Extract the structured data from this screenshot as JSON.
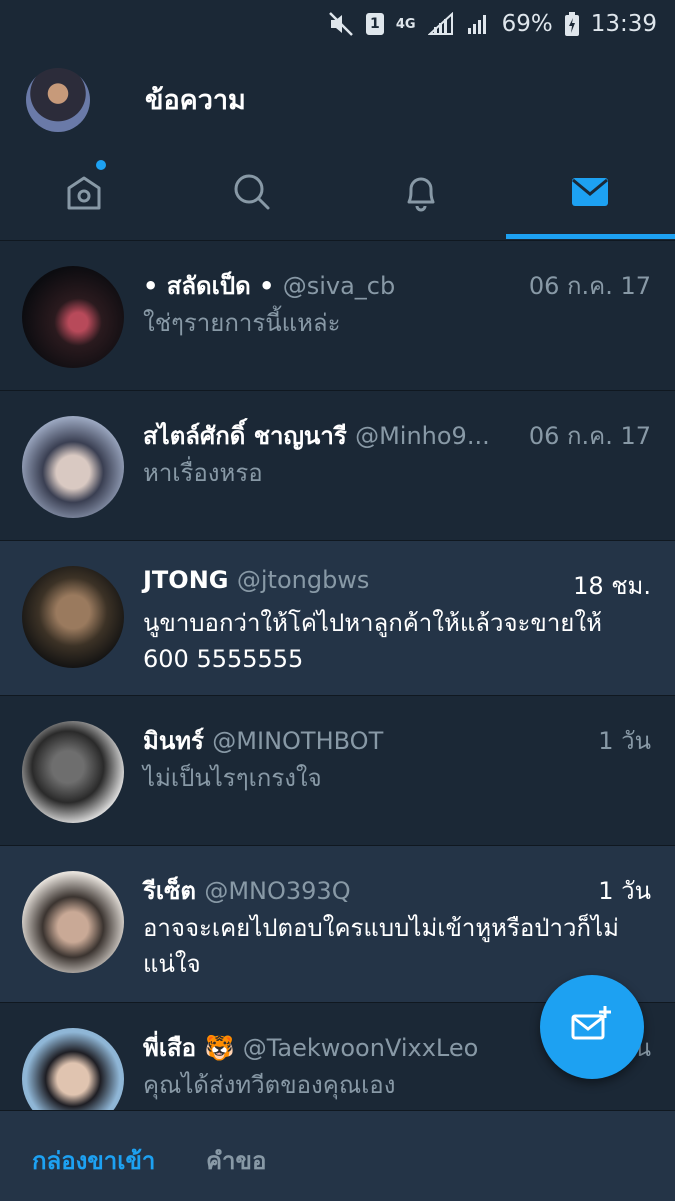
{
  "status_bar": {
    "sim_label": "1",
    "network": "4G",
    "battery": "69%",
    "time": "13:39"
  },
  "header": {
    "title": "ข้อความ"
  },
  "tabs": [
    {
      "name": "home",
      "icon": "home-icon",
      "has_dot": true
    },
    {
      "name": "search",
      "icon": "search-icon"
    },
    {
      "name": "notifications",
      "icon": "bell-icon"
    },
    {
      "name": "messages",
      "icon": "envelope-icon",
      "active": true
    }
  ],
  "conversations": [
    {
      "name": "• สลัดเป็ด •",
      "handle": "@siva_cb",
      "time": "06 ก.ค. 17",
      "message": "ใช่ๆรายการนี้แหล่ะ",
      "unread": false
    },
    {
      "name": "สไตล์ศักดิ์ ชาญนารี",
      "handle": "@Minho9...",
      "time": "06 ก.ค. 17",
      "message": "หาเรื่องหรอ",
      "unread": false
    },
    {
      "name": "JTONG",
      "handle": "@jtongbws",
      "time": "18 ชม.",
      "message": "นูขาบอกว่าให้โค่ไปหาลูกค้าให้แล้วจะขายให้ 600 5555555",
      "unread": true
    },
    {
      "name": "มินทร์",
      "handle": "@MINOTHBOT",
      "time": "1 วัน",
      "message": "ไม่เป็นไรๆเกรงใจ",
      "unread": false
    },
    {
      "name": "รีเซ็ต",
      "handle": "@MNO393Q",
      "time": "1 วัน",
      "message": "อาจจะเคยไปตอบใครแบบไม่เข้าหูหรือป่าวก็ไม่แน่ใจ",
      "unread": true
    },
    {
      "name": "พี่เสือ 🐯",
      "handle": "@TaekwoonVixxLeo",
      "time": "1 วัน",
      "message": "คุณได้ส่งทวีตของคุณเอง",
      "unread": false
    }
  ],
  "bottom_tabs": {
    "inbox": "กล่องขาเข้า",
    "requests": "คำขอ"
  },
  "fab": {
    "icon": "new-message-icon"
  },
  "colors": {
    "accent": "#1da1f2",
    "background": "#1b2836",
    "unread_row": "#243447"
  }
}
